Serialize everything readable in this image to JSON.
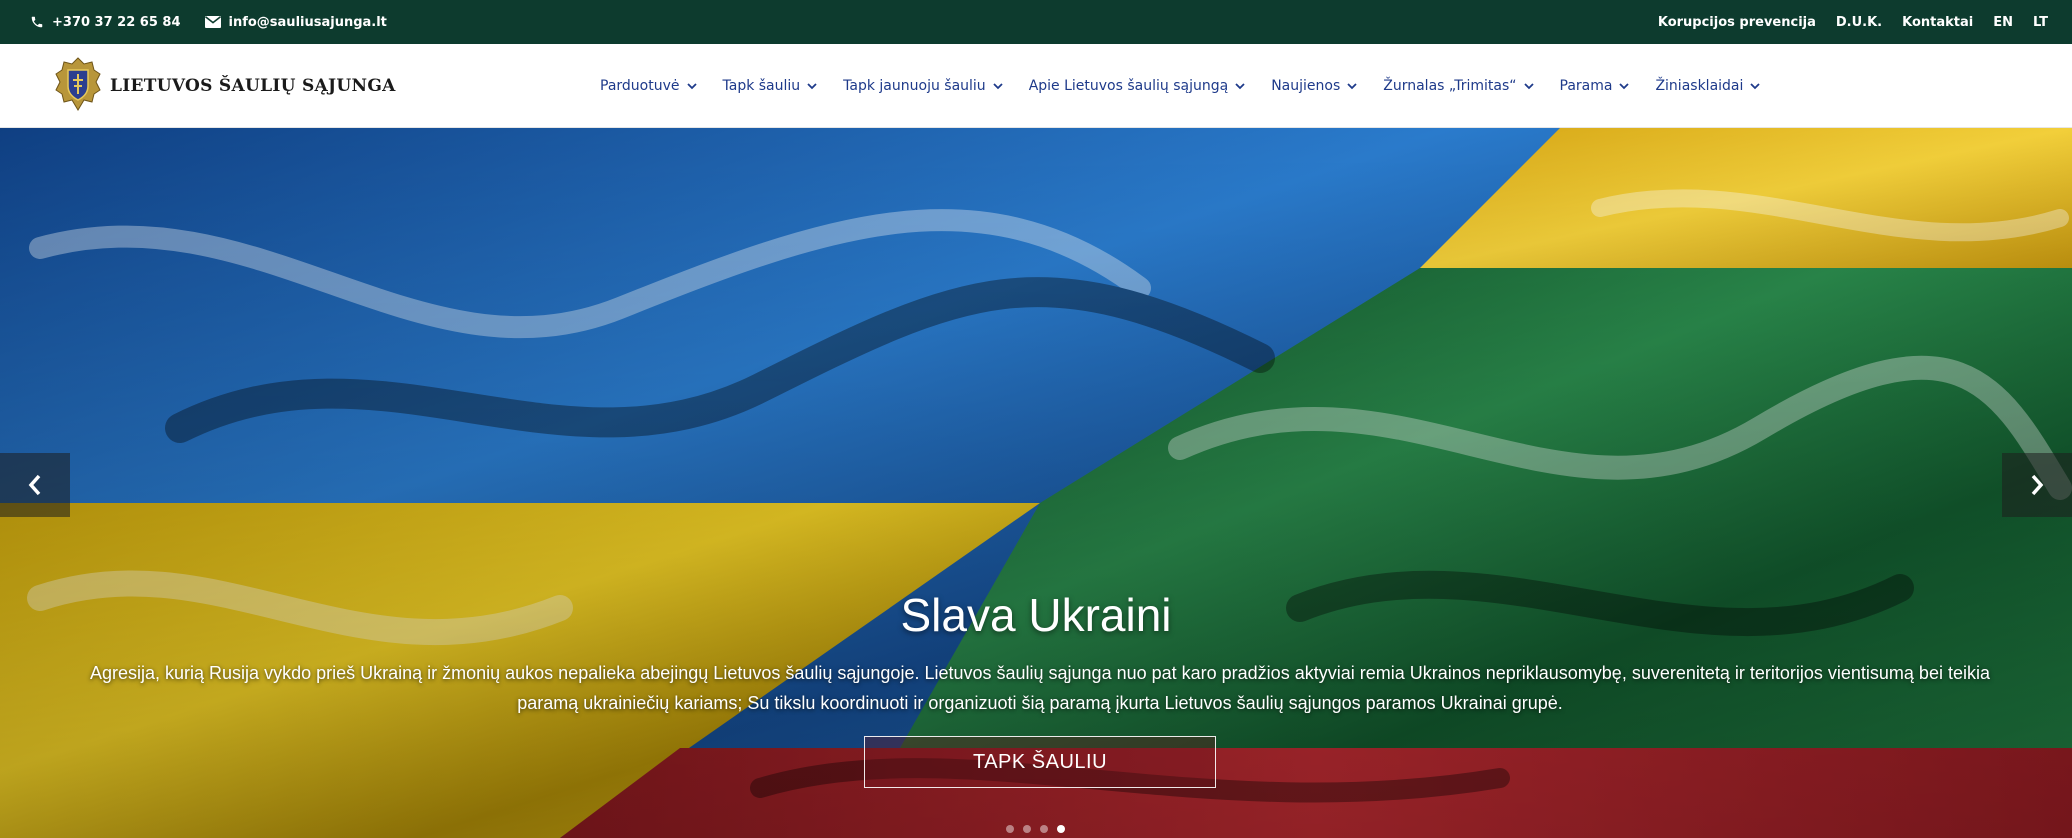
{
  "topbar": {
    "phone": "+370 37 22 65 84",
    "email": "info@sauliusajunga.lt",
    "links": [
      "Korupcijos prevencija",
      "D.U.K.",
      "Kontaktai",
      "EN",
      "LT"
    ],
    "background_color": "#0d3b2e"
  },
  "header": {
    "logo_text": "LIETUVOS ŠAULIŲ SĄJUNGA",
    "nav": [
      {
        "label": "Parduotuvė",
        "icon": "chevron-down-icon"
      },
      {
        "label": "Tapk šauliu",
        "icon": "chevron-down-icon"
      },
      {
        "label": "Tapk jaunuoju šauliu",
        "icon": "chevron-down-icon"
      },
      {
        "label": "Apie Lietuvos šaulių sąjungą",
        "icon": "chevron-down-icon"
      },
      {
        "label": "Naujienos",
        "icon": "chevron-down-icon"
      },
      {
        "label": "Žurnalas „Trimitas“",
        "icon": "chevron-down-icon"
      },
      {
        "label": "Parama",
        "icon": "chevron-down-icon"
      },
      {
        "label": "Žiniasklaidai",
        "icon": "chevron-down-icon"
      }
    ],
    "nav_color": "#1e3a8a"
  },
  "hero": {
    "title": "Slava Ukraini",
    "text": "Agresija, kurią Rusija vykdo prieš Ukrainą ir žmonių aukos nepalieka abejingų Lietuvos šaulių sąjungoje. Lietuvos šaulių sąjunga nuo pat karo pradžios aktyviai remia Ukrainos nepriklausomybę, suverenitetą ir teritorijos vientisumą bei teikia paramą ukrainiečių kariams; Su tikslu koordinuoti ir organizuoti šią paramą įkurta Lietuvos šaulių sąjungos paramos Ukrainai grupė.",
    "cta_label": "TAPK ŠAULIU",
    "slide_count": 4,
    "active_slide": 4,
    "colors": {
      "ukraine_blue": "#1c63b0",
      "ukraine_yellow": "#e8c21a",
      "lithuania_yellow": "#e6b820",
      "lithuania_green": "#1d6b3a",
      "lithuania_red": "#b3232a"
    }
  }
}
